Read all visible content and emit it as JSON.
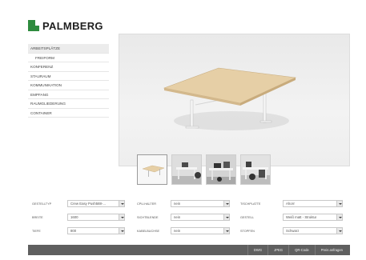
{
  "brand": {
    "name": "PALMBERG"
  },
  "sidebar": {
    "items": [
      {
        "label": "ARBEITSPLÄTZE"
      },
      {
        "label": "FREIFORM"
      },
      {
        "label": "KONFERENZ"
      },
      {
        "label": "STAURAUM"
      },
      {
        "label": "KOMMUNIKATION"
      },
      {
        "label": "EMPFANG"
      },
      {
        "label": "RAUMGLIEDERUNG"
      },
      {
        "label": "CONTAINER"
      }
    ]
  },
  "thumbnails": [
    {
      "name": "table-render"
    },
    {
      "name": "photo-office-1"
    },
    {
      "name": "photo-office-2"
    },
    {
      "name": "photo-office-3"
    }
  ],
  "config": {
    "col1": [
      {
        "label": "GESTELLTYP",
        "value": "Crew Easy Push588-..."
      },
      {
        "label": "BREITE",
        "value": "1600"
      },
      {
        "label": "TIEFE",
        "value": "800"
      }
    ],
    "col2": [
      {
        "label": "CPU-HALTER",
        "value": "nein"
      },
      {
        "label": "SICHTBLENDE",
        "value": "nein"
      },
      {
        "label": "KABELBUCHSE",
        "value": "nein"
      }
    ],
    "col3": [
      {
        "label": "TISCHPLATTE",
        "value": "Ahorn"
      },
      {
        "label": "GESTELL",
        "value": "Weiß matt - Struktur"
      },
      {
        "label": "STOPFEN",
        "value": "Schwarz"
      }
    ]
  },
  "footer": {
    "buttons": [
      {
        "label": "DWG"
      },
      {
        "label": "JPEG"
      },
      {
        "label": "QR-Code"
      },
      {
        "label": "Preis anfragen"
      }
    ]
  },
  "colors": {
    "brand_green": "#2e8b3e",
    "footer_bg": "#5f5f5f",
    "tabletop": "#e6cfa6"
  }
}
